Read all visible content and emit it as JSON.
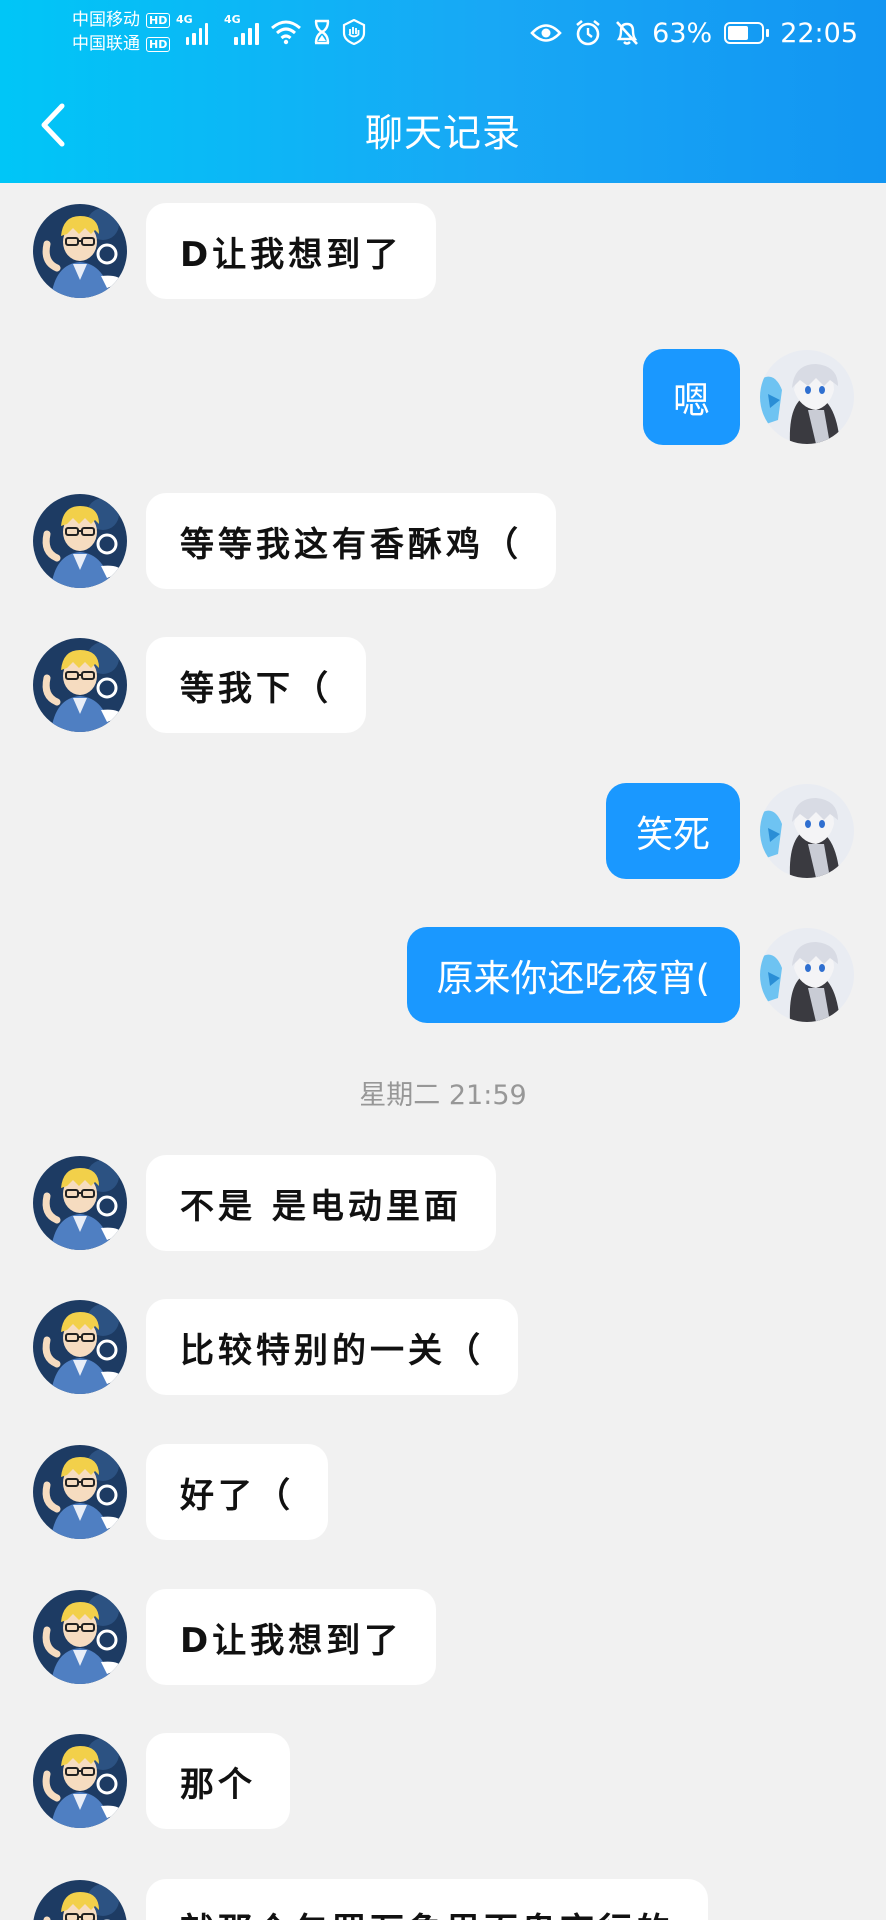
{
  "status_bar": {
    "carrier_1": "中国移动",
    "carrier_2": "中国联通",
    "hd": "HD",
    "network": "4G",
    "battery": "63%",
    "battery_level": 0.63,
    "time": "22:05"
  },
  "header": {
    "title": "聊天记录"
  },
  "messages": [
    {
      "side": "in",
      "text": "D让我想到了"
    },
    {
      "side": "out",
      "text": "嗯"
    },
    {
      "side": "in",
      "text": "等等我这有香酥鸡（"
    },
    {
      "side": "in",
      "text": "等我下（"
    },
    {
      "side": "out",
      "text": "笑死"
    },
    {
      "side": "out",
      "text": "原来你还吃夜宵("
    },
    {
      "side": "time",
      "text": "星期二 21:59"
    },
    {
      "side": "in",
      "text": "不是 是电动里面"
    },
    {
      "side": "in",
      "text": "比较特别的一关（"
    },
    {
      "side": "in",
      "text": "好了（"
    },
    {
      "side": "in",
      "text": "D让我想到了"
    },
    {
      "side": "in",
      "text": "那个"
    },
    {
      "side": "in",
      "text": "就那个包罗万象里百鬼夜行的"
    }
  ],
  "colors": {
    "header_start": "#00c6f7",
    "header_end": "#1295f2",
    "outgoing_bubble": "#1a98ff",
    "incoming_bubble": "#ffffff",
    "background": "#f1f1f1"
  }
}
